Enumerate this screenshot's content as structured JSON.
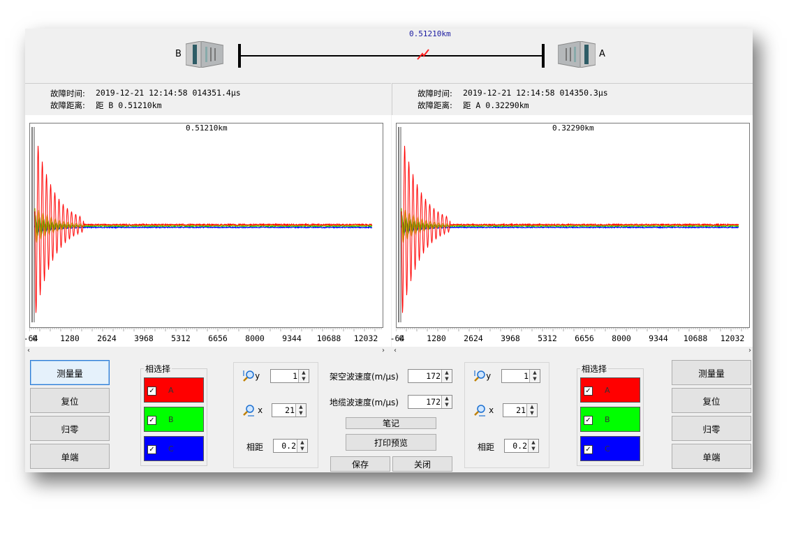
{
  "top": {
    "station_left": "B",
    "station_right": "A",
    "fault_distance": "0.51210km"
  },
  "info_left": {
    "fault_time_label": "故障时间:",
    "fault_time_value": "2019-12-21 12:14:58 014351.4μs",
    "fault_distance_label": "故障距离:",
    "fault_distance_value": "距 B 0.51210km"
  },
  "info_right": {
    "fault_time_label": "故障时间:",
    "fault_time_value": "2019-12-21 12:14:58 014350.3μs",
    "fault_distance_label": "故障距离:",
    "fault_distance_value": "距 A 0.32290km"
  },
  "plot_left": {
    "title": "0.51210km",
    "x_ticks": [
      "-64",
      "0",
      "1280",
      "2624",
      "3968",
      "5312",
      "6656",
      "8000",
      "9344",
      "10688",
      "12032"
    ]
  },
  "plot_right": {
    "title": "0.32290km",
    "x_ticks": [
      "-64",
      "0",
      "1280",
      "2624",
      "3968",
      "5312",
      "6656",
      "8000",
      "9344",
      "10688",
      "12032"
    ]
  },
  "scroll": {
    "left_arrow": "‹",
    "right_arrow": "›"
  },
  "left_buttons": {
    "measure": "测量量",
    "reset": "复位",
    "zero": "归零",
    "single": "单端"
  },
  "right_buttons": {
    "measure": "测量量",
    "reset": "复位",
    "zero": "归零",
    "single": "单端"
  },
  "phase_left": {
    "title": "相选择",
    "phases": [
      {
        "label": "A",
        "color": "#ff0000",
        "checked": "✓"
      },
      {
        "label": "B",
        "color": "#00ff00",
        "checked": "✓"
      },
      {
        "label": "C",
        "color": "#0000ff",
        "checked": "✓"
      }
    ]
  },
  "phase_right": {
    "title": "相选择",
    "phases": [
      {
        "label": "A",
        "color": "#ff0000",
        "checked": "✓"
      },
      {
        "label": "B",
        "color": "#00ff00",
        "checked": "✓"
      },
      {
        "label": "C",
        "color": "#0000ff",
        "checked": "✓"
      }
    ]
  },
  "zoom_left": {
    "y_label": "y",
    "y_value": "1",
    "x_label": "x",
    "x_value": "21",
    "spacing_label": "相距",
    "spacing_value": "0.2"
  },
  "zoom_right": {
    "y_label": "y",
    "y_value": "1",
    "x_label": "x",
    "x_value": "21",
    "spacing_label": "相距",
    "spacing_value": "0.2"
  },
  "center": {
    "overhead_speed_label": "架空波速度(m/μs)",
    "overhead_speed_value": "172",
    "cable_speed_label": "地缆波速度(m/μs)",
    "cable_speed_value": "172",
    "notes_button": "笔记",
    "print_preview_button": "打印预览",
    "save_button": "保存",
    "close_button": "关闭"
  },
  "colors": {
    "phase_a": "#ff0000",
    "phase_b": "#00cc00",
    "phase_c": "#0000ff",
    "fault_marker": "#ff2020"
  }
}
